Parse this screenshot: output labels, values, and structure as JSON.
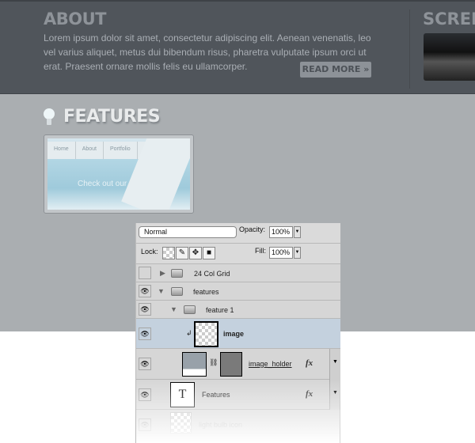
{
  "about": {
    "title": "ABOUT",
    "text": "Lorem ipsum dolor sit amet, consectetur adipiscing elit. Aenean venenatis, leo vel varius aliquet, metus dui bibendum risus, pharetra vulputate ipsum orci ut erat. Praesent ornare mollis felis eu ullamcorper.",
    "read_more": "READ MORE »"
  },
  "screenshots": {
    "title": "SCREEN"
  },
  "features": {
    "title": "FEATURES",
    "thumb_nav": [
      "Home",
      "About",
      "Portfolio"
    ],
    "thumb_text": "Check out our"
  },
  "layers_panel": {
    "blend_mode": "Normal",
    "opacity_label": "Opacity:",
    "opacity": "100%",
    "lock_label": "Lock:",
    "fill_label": "Fill:",
    "fill": "100%",
    "layers": [
      {
        "name": "24 Col Grid",
        "visible": false,
        "type": "group",
        "expanded": false
      },
      {
        "name": "features",
        "visible": true,
        "type": "group",
        "expanded": true
      },
      {
        "name": "feature 1",
        "visible": true,
        "type": "group",
        "expanded": true
      },
      {
        "name": "image",
        "visible": true,
        "type": "layer",
        "selected": true,
        "clipped": true
      },
      {
        "name": "image_holder",
        "visible": true,
        "type": "layer",
        "mask": true,
        "fx": "fx"
      },
      {
        "name": "Features",
        "visible": true,
        "type": "text",
        "thumb": "T",
        "fx": "fx"
      },
      {
        "name": "light bulb icon",
        "visible": true,
        "type": "layer"
      }
    ]
  },
  "colors": {
    "dark_band": "#50555b",
    "mid_band": "#aaaeb1",
    "selected_layer": "#c4d1de"
  }
}
